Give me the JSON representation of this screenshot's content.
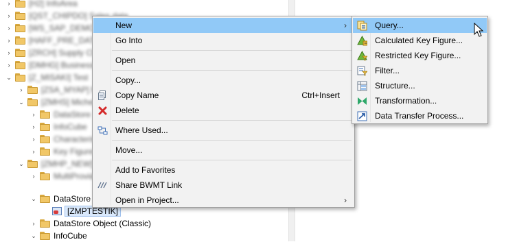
{
  "tree": {
    "blurred_rows": [
      "[H2] InfoArea",
      "[QST_CHIPDO] Sales data",
      "[WS_SAP_DEMO] Demo",
      "[HAFF_PRE_DAT] Prices",
      "[ZRCH] Supply Chain",
      "[DMHG] Business Hub",
      "[Z_MISAKI] Test",
      "[ZSA_MYAP] Michel",
      "[ZMHS] Michel area",
      "DataStore",
      "InfoCube",
      "Characteristic",
      "Key Figure",
      "[ZMHP_NEW] Michel",
      "MultiProvider"
    ],
    "datastore_label": "DataStore",
    "selected_item": "[ZMPTESTIK]",
    "datastore_classic": "DataStore Object (Classic)",
    "infocube": "InfoCube"
  },
  "context_menu": {
    "items": [
      {
        "label": "New",
        "shortcut": "",
        "icon": "none",
        "submenu": true
      },
      {
        "label": "Go Into",
        "shortcut": "",
        "icon": "none",
        "submenu": false
      },
      {
        "label": "Open",
        "shortcut": "",
        "icon": "none",
        "submenu": false
      },
      {
        "label": "Copy...",
        "shortcut": "",
        "icon": "none",
        "submenu": false
      },
      {
        "label": "Copy Name",
        "shortcut": "Ctrl+Insert",
        "icon": "copy-name-icon",
        "submenu": false
      },
      {
        "label": "Delete",
        "shortcut": "",
        "icon": "delete-icon",
        "submenu": false
      },
      {
        "label": "Where Used...",
        "shortcut": "",
        "icon": "where-used-icon",
        "submenu": false
      },
      {
        "label": "Move...",
        "shortcut": "",
        "icon": "none",
        "submenu": false
      },
      {
        "label": "Add to Favorites",
        "shortcut": "",
        "icon": "none",
        "submenu": false
      },
      {
        "label": "Share BWMT Link",
        "shortcut": "",
        "icon": "share-link-icon",
        "submenu": false
      },
      {
        "label": "Open in Project...",
        "shortcut": "",
        "icon": "none",
        "submenu": true
      }
    ]
  },
  "submenu": {
    "items": [
      {
        "label": "Query...",
        "icon": "query-icon"
      },
      {
        "label": "Calculated Key Figure...",
        "icon": "calculated-key-figure-icon"
      },
      {
        "label": "Restricted Key Figure...",
        "icon": "restricted-key-figure-icon"
      },
      {
        "label": "Filter...",
        "icon": "filter-icon"
      },
      {
        "label": "Structure...",
        "icon": "structure-icon"
      },
      {
        "label": "Transformation...",
        "icon": "transformation-icon"
      },
      {
        "label": "Data Transfer Process...",
        "icon": "data-transfer-process-icon"
      }
    ]
  },
  "colors": {
    "highlight": "#91c9f7",
    "menu_bg": "#f2f2f2",
    "folder": "#f1c767"
  }
}
